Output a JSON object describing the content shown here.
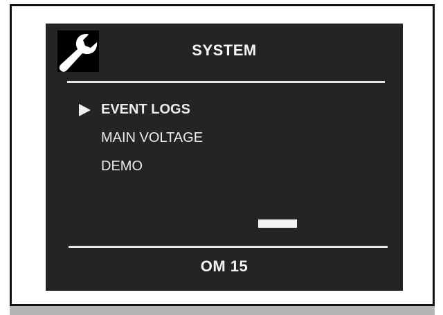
{
  "screen": {
    "title": "SYSTEM",
    "header_icon": "wrench-icon",
    "footer_label": "OM 15",
    "selected_index": 0
  },
  "menu": {
    "items": [
      {
        "label": "EVENT LOGS",
        "selected": true
      },
      {
        "label": "MAIN VOLTAGE",
        "selected": false
      },
      {
        "label": "DEMO",
        "selected": false
      }
    ]
  },
  "colors": {
    "screen_background": "#242424",
    "text": "#f4f4f4",
    "icon_background": "#000000",
    "frame_border": "#111111"
  }
}
